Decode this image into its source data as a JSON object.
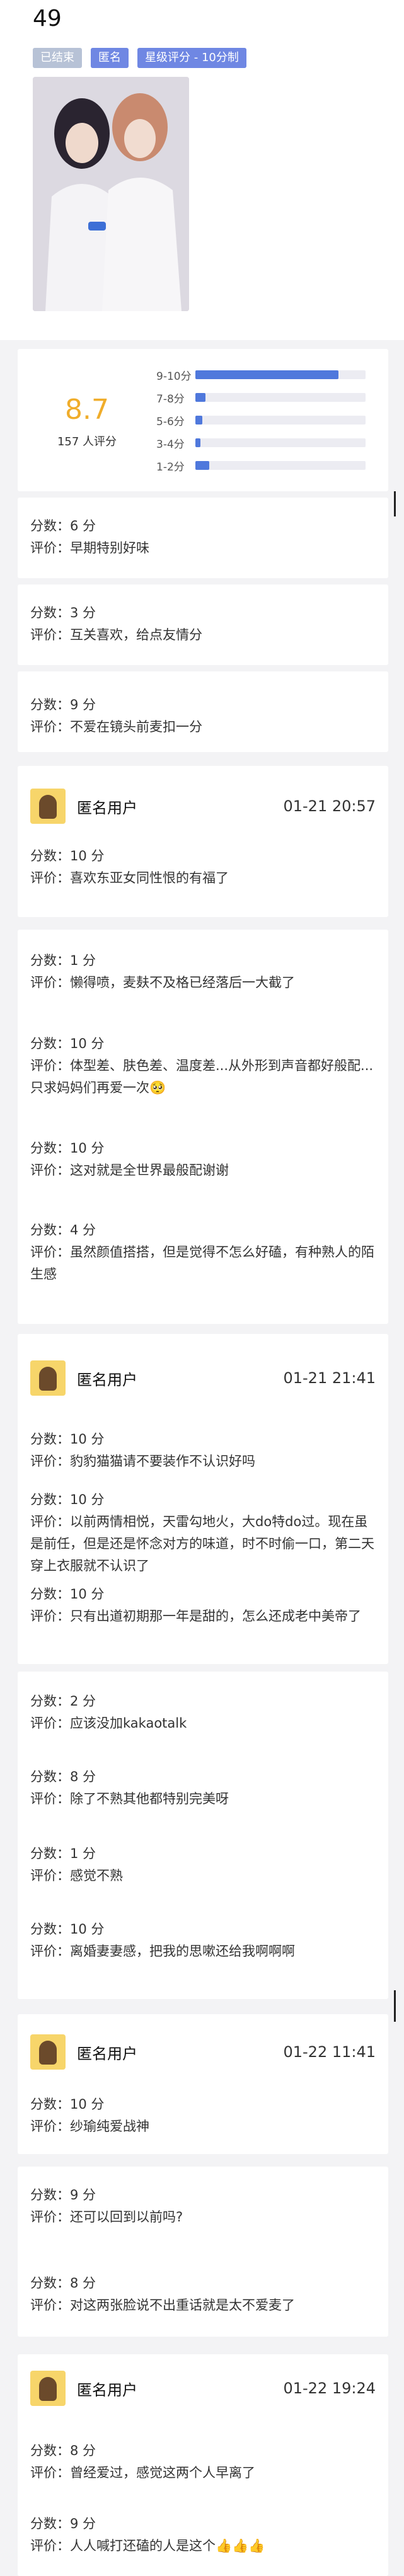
{
  "page": {
    "title": "49",
    "tags": [
      "已结束",
      "匿名",
      "星级评分 - 10分制"
    ]
  },
  "summary": {
    "average": "8.7",
    "raters": "157 人评分",
    "distribution": [
      {
        "label": "9-10分",
        "fraction": 0.84
      },
      {
        "label": "7-8分",
        "fraction": 0.06
      },
      {
        "label": "5-6分",
        "fraction": 0.04
      },
      {
        "label": "3-4分",
        "fraction": 0.03
      },
      {
        "label": "1-2分",
        "fraction": 0.08
      }
    ]
  },
  "labels": {
    "anonymous_user": "匿名用户"
  },
  "cards": [
    {
      "entries": [
        {
          "score": "分数：6 分",
          "comment": "评价：早期特别好味"
        }
      ]
    },
    {
      "entries": [
        {
          "score": "分数：3 分",
          "comment": "评价：互关喜欢，给点友情分"
        }
      ]
    },
    {
      "entries": [
        {
          "score": "分数：9 分",
          "comment": "评价：不爱在镜头前麦扣一分"
        }
      ]
    },
    {
      "user": {
        "name": "匿名用户",
        "time": "01-21 20:57"
      },
      "entries": [
        {
          "score": "分数：10 分",
          "comment": "评价：喜欢东亚女同性恨的有福了"
        }
      ]
    },
    {
      "entries": [
        {
          "score": "分数：1 分",
          "comment": "评价：懒得喷，麦麸不及格已经落后一大截了"
        },
        {
          "score": "分数：10 分",
          "comment": "评价：体型差、肤色差、温度差...从外形到声音都好般配...只求妈妈们再爱一次🥺"
        },
        {
          "score": "分数：10 分",
          "comment": "评价：这对就是全世界最般配谢谢"
        },
        {
          "score": "分数：4 分",
          "comment": "评价：虽然颜值搭搭，但是觉得不怎么好磕，有种熟人的陌生感"
        }
      ]
    },
    {
      "user": {
        "name": "匿名用户",
        "time": "01-21 21:41"
      },
      "entries": [
        {
          "score": "分数：10 分",
          "comment": "评价：豹豹猫猫请不要装作不认识好吗"
        },
        {
          "score": "分数：10 分",
          "comment": "评价：以前两情相悦，天雷勾地火，大do特do过。现在虽是前任，但是还是怀念对方的味道，时不时偷一口，第二天穿上衣服就不认识了"
        },
        {
          "score": "分数：10 分",
          "comment": "评价：只有出道初期那一年是甜的，怎么还成老中美帝了"
        }
      ]
    },
    {
      "entries": [
        {
          "score": "分数：2 分",
          "comment": "评价：应该没加kakaotalk"
        },
        {
          "score": "分数：8 分",
          "comment": "评价：除了不熟其他都特别完美呀"
        },
        {
          "score": "分数：1 分",
          "comment": "评价：感觉不熟"
        },
        {
          "score": "分数：10 分",
          "comment": "评价：离婚妻妻感，把我的思嗽还给我啊啊啊"
        }
      ]
    },
    {
      "user": {
        "name": "匿名用户",
        "time": "01-22 11:41"
      },
      "entries": [
        {
          "score": "分数：10 分",
          "comment": "评价：纱瑜纯爱战神"
        }
      ]
    },
    {
      "entries": [
        {
          "score": "分数：9 分",
          "comment": "评价：还可以回到以前吗?"
        },
        {
          "score": "分数：8 分",
          "comment": "评价：对这两张脸说不出重话就是太不爱麦了"
        }
      ]
    },
    {
      "user": {
        "name": "匿名用户",
        "time": "01-22 19:24"
      },
      "entries": [
        {
          "score": "分数：8 分",
          "comment": "评价：曾经爱过，感觉这两个人早离了"
        },
        {
          "score": "分数：9 分",
          "comment": "评价：人人喊打还磕的人是这个👍👍👍"
        }
      ]
    }
  ],
  "colors": {
    "accent": "#f0ad2b",
    "bar": "#4f78dc",
    "tag": "#b7c2d6",
    "tag_blue": "#6f87e3"
  }
}
